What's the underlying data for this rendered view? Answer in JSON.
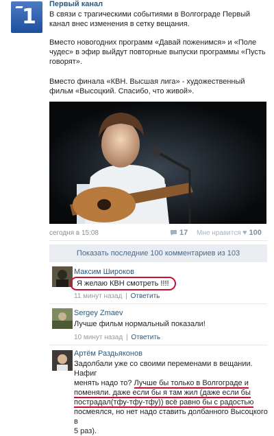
{
  "post": {
    "author": "Первый канал",
    "paragraphs": [
      "В связи с трагическими событиями в Волгограде Первый канал внес изменения в сетку вещания.",
      "Вместо новогодних программ «Давай поженимся» и «Поле чудес» в эфир выйдут повторные выпуски программы «Пусть говорят».",
      "Вместо финала «КВН. Высшая лига» - художественный фильм «Высоцкий. Спасибо, что живой»."
    ],
    "timestamp": "сегодня в 15:08",
    "comments_count": "17",
    "like_label": "Мне нравится",
    "likes_count": "100"
  },
  "show_all": "Показать последние 100 комментариев из 103",
  "comments": [
    {
      "author": "Максим Широков",
      "text": "Я желаю КВН смотреть !!!!",
      "time": "11 минут назад",
      "reply": "Ответить"
    },
    {
      "author": "Sergey Zmaev",
      "text": "Лучше фильм нормальный показали!",
      "time": "10 минут назад",
      "reply": "Ответить"
    },
    {
      "author": "Артём Раздьяконов",
      "text_lines": [
        "Задолбали уже со своими переменами в вещании. Нафиг",
        "менять надо то?",
        "Лучше бы только в Волгограде и",
        "поменяли. даже если бы я там жил (даже если бы",
        "пострадал(тфу-тфу-тфу)) всё равно бы с радостью",
        "посмеялся, но нет надо ставить долбанного Высоцкого в",
        "5 раз)."
      ]
    }
  ],
  "colors": {
    "link": "#2b587a",
    "annotation": "#c8102e",
    "button_bg": "#e9edf2"
  }
}
